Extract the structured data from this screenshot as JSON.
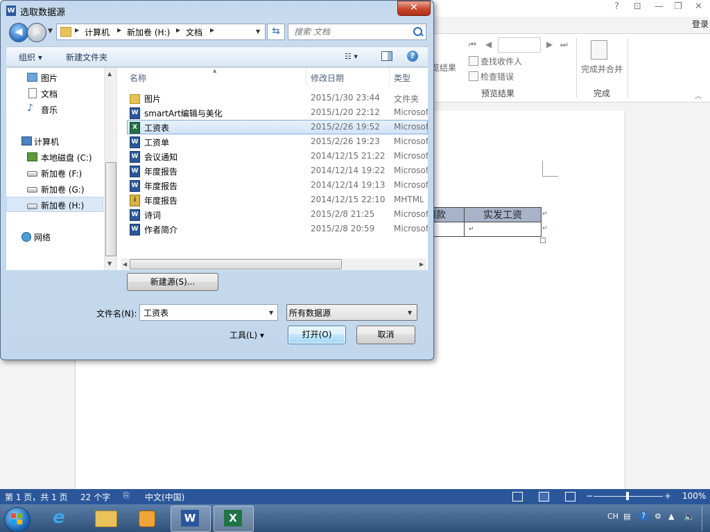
{
  "word": {
    "login": "登录",
    "title_controls": [
      "?",
      "⊡",
      "—",
      "❐",
      "✕"
    ],
    "ribbon": {
      "preview_partial": "览结果",
      "find_recipient": "查找收件人",
      "check_errors": "检查错误",
      "group_preview": "预览结果",
      "finish_merge": "完成并合并",
      "group_finish": "完成",
      "nav_first": "⏮",
      "nav_prev": "◀",
      "nav_next": "▶",
      "nav_last": "⏭",
      "collapse": "︿"
    },
    "table": {
      "col1_partial": "扣款",
      "col2": "实发工资",
      "para_mark": "↵"
    }
  },
  "statusbar": {
    "page": "第 1 页，共 1 页",
    "words": "22 个字",
    "lang": "中文(中国)",
    "zoom_minus": "−",
    "zoom_plus": "+",
    "zoom": "100%"
  },
  "taskbar": {
    "apps": [
      "internet-explorer",
      "file-explorer",
      "media-player",
      "word",
      "excel"
    ],
    "tray": {
      "ime": "CH",
      "clock_hidden": ""
    }
  },
  "dialog": {
    "title": "选取数据源",
    "close": "✕",
    "nav": {
      "back": "◀",
      "forward": "▶",
      "crumbs": [
        "计算机",
        "新加卷 (H:)",
        "文档"
      ],
      "search_placeholder": "搜索 文档"
    },
    "toolbar": {
      "organize": "组织 ▾",
      "new_folder": "新建文件夹",
      "view": "☷ ▾",
      "help": "?"
    },
    "nav_pane": [
      {
        "label": "图片",
        "icon": "pictures-icon"
      },
      {
        "label": "文档",
        "icon": "documents-icon"
      },
      {
        "label": "音乐",
        "icon": "music-icon"
      },
      {
        "label": "计算机",
        "icon": "computer-icon"
      },
      {
        "label": "本地磁盘 (C:)",
        "icon": "system-drive-icon"
      },
      {
        "label": "新加卷 (F:)",
        "icon": "drive-icon"
      },
      {
        "label": "新加卷 (G:)",
        "icon": "drive-icon"
      },
      {
        "label": "新加卷 (H:)",
        "icon": "drive-icon",
        "selected": true
      },
      {
        "label": "网络",
        "icon": "network-icon"
      }
    ],
    "columns": {
      "name": "名称",
      "date": "修改日期",
      "type": "类型"
    },
    "files": [
      {
        "name": "图片",
        "date": "2015/1/30 23:44",
        "type": "文件夹",
        "icon": "folder"
      },
      {
        "name": "smartArt编辑与美化",
        "date": "2015/1/20 22:12",
        "type": "Microsof",
        "icon": "word"
      },
      {
        "name": "工资表",
        "date": "2015/2/26 19:52",
        "type": "Microsof",
        "icon": "excel",
        "selected": true
      },
      {
        "name": "工资单",
        "date": "2015/2/26 19:23",
        "type": "Microsof",
        "icon": "word"
      },
      {
        "name": "会议通知",
        "date": "2014/12/15 21:22",
        "type": "Microsof",
        "icon": "word"
      },
      {
        "name": "年度报告",
        "date": "2014/12/14 19:22",
        "type": "Microsof",
        "icon": "word"
      },
      {
        "name": "年度报告",
        "date": "2014/12/14 19:13",
        "type": "Microsof",
        "icon": "word"
      },
      {
        "name": "年度报告",
        "date": "2014/12/15 22:10",
        "type": "MHTML",
        "icon": "mhtml"
      },
      {
        "name": "诗词",
        "date": "2015/2/8 21:25",
        "type": "Microsof",
        "icon": "word"
      },
      {
        "name": "作者简介",
        "date": "2015/2/8 20:59",
        "type": "Microsof",
        "icon": "word"
      }
    ],
    "new_source": "新建源(S)...",
    "filename_label": "文件名(N):",
    "filename_value": "工资表",
    "filter_value": "所有数据源",
    "tools": "工具(L)  ▾",
    "open": "打开(O)",
    "cancel": "取消"
  },
  "colors": {
    "word_blue": "#2b579a",
    "excel_green": "#217346",
    "selection": "#d1e3f8"
  }
}
